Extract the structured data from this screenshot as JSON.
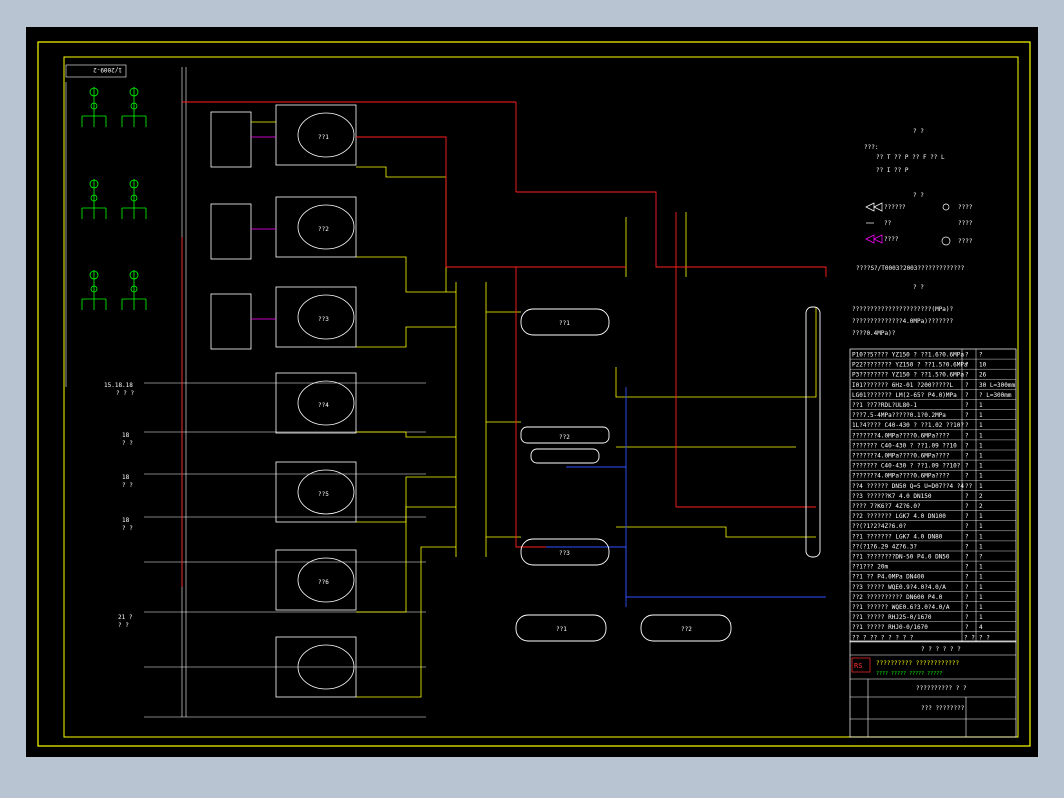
{
  "sheet": {
    "number": "1/2009-2"
  },
  "colors": {
    "background": "#000000",
    "frame": "#ffff00",
    "pipe_red": "#ff2020",
    "pipe_yellow": "#ffff00",
    "pipe_white": "#ffffff",
    "pipe_blue": "#3050ff",
    "pipe_magenta": "#ff00ff",
    "equipment_green": "#00ff00"
  },
  "legend": {
    "header_1": "? ?",
    "header_2": "? ?",
    "header_3": "? ?",
    "row1": "???:",
    "row2": "?? T   ?? P   ?? F   ?? L",
    "row3": "?? I   ?? P",
    "valve1": "??????",
    "valve2": "????",
    "valve3": "??",
    "valve4": "????",
    "valve5": "????",
    "valve6": "????",
    "note1": "????S?/T0003?2003?????????????",
    "note2": "??????????????????????(MPa)?",
    "note3": "??????????????4.0MPa)???????",
    "note4": "????0.4MPa)?"
  },
  "left_labels": {
    "l1": "15.18.18",
    "l2": "? ? ?",
    "l3": "18",
    "l4": "? ?",
    "l5": "18",
    "l6": "? ?",
    "l7": "18",
    "l8": "? ?",
    "l9": "21 ?",
    "l10": "? ?"
  },
  "equipment": {
    "e1": "??1",
    "e2": "??2",
    "e3": "??3",
    "e4": "??4",
    "e5": "??5",
    "e6": "??6",
    "h1": "??1",
    "h2": "??2",
    "h3": "??3",
    "t1": "??1",
    "t2": "??2"
  },
  "equipment_table": {
    "rows": [
      {
        "c1": "P10??5???? YZ150 ?  ??1.6?0.6MPa",
        "c2": "?",
        "c3": "?"
      },
      {
        "c1": "P22???????? YZ150 ?  ??1.5?0.6MPa",
        "c2": "?",
        "c3": "10"
      },
      {
        "c1": "P3???????? YZ150 ?  ??1.5?0.6MPa",
        "c2": "?",
        "c3": "26"
      },
      {
        "c1": "I01??????? 6Hz-01 ?200?????L",
        "c2": "?",
        "c3": "30  L=300mm"
      },
      {
        "c1": "LG01??????? LM(2-65? P4.0)MPa",
        "c2": "?",
        "c3": "?  L=300mm"
      },
      {
        "c1": "??1  ??7?RDL?UL80-1",
        "c2": "?",
        "c3": "1"
      },
      {
        "c1": "???7.5-4MPa?????0.1?0.2MPa",
        "c2": "?",
        "c3": "1"
      },
      {
        "c1": "1L?4???? C40-430 ? ??1.02 ??10?",
        "c2": "?",
        "c3": "1"
      },
      {
        "c1": "???????4.0MPa????0.6MPa????",
        "c2": "?",
        "c3": "1"
      },
      {
        "c1": "??????? C40-430 ? ??1.09 ??10",
        "c2": "?",
        "c3": "1"
      },
      {
        "c1": "???????4.0MPa????0.6MPa????",
        "c2": "?",
        "c3": "1"
      },
      {
        "c1": "??????? C40-430 ? ??1.09 ??10?",
        "c2": "?",
        "c3": "1"
      },
      {
        "c1": "???????4.0MPa????0.6MPa????",
        "c2": "?",
        "c3": "1"
      },
      {
        "c1": "??4 ?????? DN50 Q=5 U=D07??4 ?4",
        "c2": "??",
        "c3": "1"
      },
      {
        "c1": "??3 ??????K7 4.0 DN150",
        "c2": "?",
        "c3": "2"
      },
      {
        "c1": "???? 7?K6?7 4Z?6.0?",
        "c2": "?",
        "c3": "2"
      },
      {
        "c1": "??2 ??????? LGK7 4.0 DN100",
        "c2": "?",
        "c3": "1"
      },
      {
        "c1": "??(?1?2?4Z?6.0?",
        "c2": "?",
        "c3": "1"
      },
      {
        "c1": "??1 ??????? LGK7 4.0 DN80",
        "c2": "?",
        "c3": "1"
      },
      {
        "c1": "??(?1?6.29 4Z?6.3?",
        "c2": "?",
        "c3": "1"
      },
      {
        "c1": "??1 ????????DN-50 P4.0 DN50",
        "c2": "?",
        "c3": "?"
      },
      {
        "c1": "??1??? 20m",
        "c2": "?",
        "c3": "1"
      },
      {
        "c1": "??1 ?? P4.0MPa DN400",
        "c2": "?",
        "c3": "1"
      },
      {
        "c1": "??3 ????? WQE0.9?4.0?4.0/A",
        "c2": "?",
        "c3": "1"
      },
      {
        "c1": "??2 ?????????? DN600 P4.0",
        "c2": "?",
        "c3": "1"
      },
      {
        "c1": "??1 ?????? WQE0.6?3.0?4.0/A",
        "c2": "?",
        "c3": "1"
      },
      {
        "c1": "??1 ????? RHJ25-0/1670",
        "c2": "?",
        "c3": "1"
      },
      {
        "c1": "??1 ????? RHJ0-0/1670",
        "c2": "?",
        "c3": "4"
      }
    ],
    "header": {
      "c1": "?? ? ?? ? ? ? ? ?",
      "c2": "? ?",
      "c3": "? ?"
    }
  },
  "title_block": {
    "caption": "? ? ? ? ? ?",
    "company": "?????????? ????????????",
    "company_sub": "???? ?????  ?????  ?????",
    "project": "?????????? ? ?",
    "drawing": "??? ????????",
    "logo": "RS"
  }
}
